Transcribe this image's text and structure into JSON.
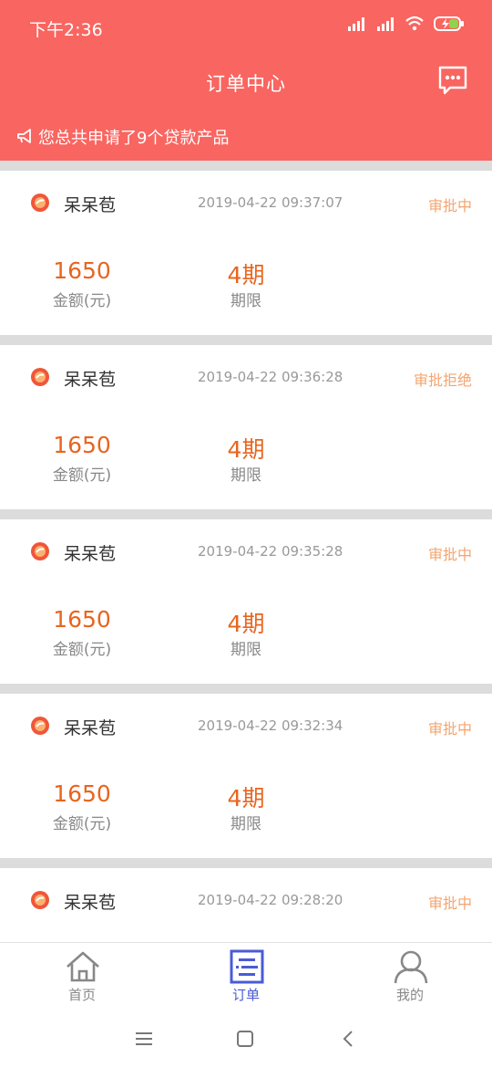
{
  "status_bar": {
    "time": "下午2:36"
  },
  "header": {
    "title": "订单中心"
  },
  "notice": {
    "text": "您总共申请了9个贷款产品"
  },
  "orders": [
    {
      "name": "呆呆苞",
      "time": "2019-04-22 09:37:07",
      "status": "审批中",
      "amount": "1650",
      "amount_label": "金额(元)",
      "term": "4期",
      "term_label": "期限"
    },
    {
      "name": "呆呆苞",
      "time": "2019-04-22 09:36:28",
      "status": "审批拒绝",
      "amount": "1650",
      "amount_label": "金额(元)",
      "term": "4期",
      "term_label": "期限"
    },
    {
      "name": "呆呆苞",
      "time": "2019-04-22 09:35:28",
      "status": "审批中",
      "amount": "1650",
      "amount_label": "金额(元)",
      "term": "4期",
      "term_label": "期限"
    },
    {
      "name": "呆呆苞",
      "time": "2019-04-22 09:32:34",
      "status": "审批中",
      "amount": "1650",
      "amount_label": "金额(元)",
      "term": "4期",
      "term_label": "期限"
    },
    {
      "name": "呆呆苞",
      "time": "2019-04-22 09:28:20",
      "status": "审批中",
      "amount": "",
      "amount_label": "",
      "term": "",
      "term_label": ""
    }
  ],
  "bottom_nav": {
    "home": "首页",
    "orders": "订单",
    "mine": "我的"
  },
  "colors": {
    "brand": "#f96560",
    "accent_orange": "#e8651f",
    "status_orange": "#f5a46e",
    "nav_active": "#4a5bd6"
  },
  "icons": {
    "header_right": "message-dots-icon",
    "notice": "megaphone-icon",
    "nav_home": "home-icon",
    "nav_orders": "order-list-icon",
    "nav_mine": "user-icon"
  }
}
